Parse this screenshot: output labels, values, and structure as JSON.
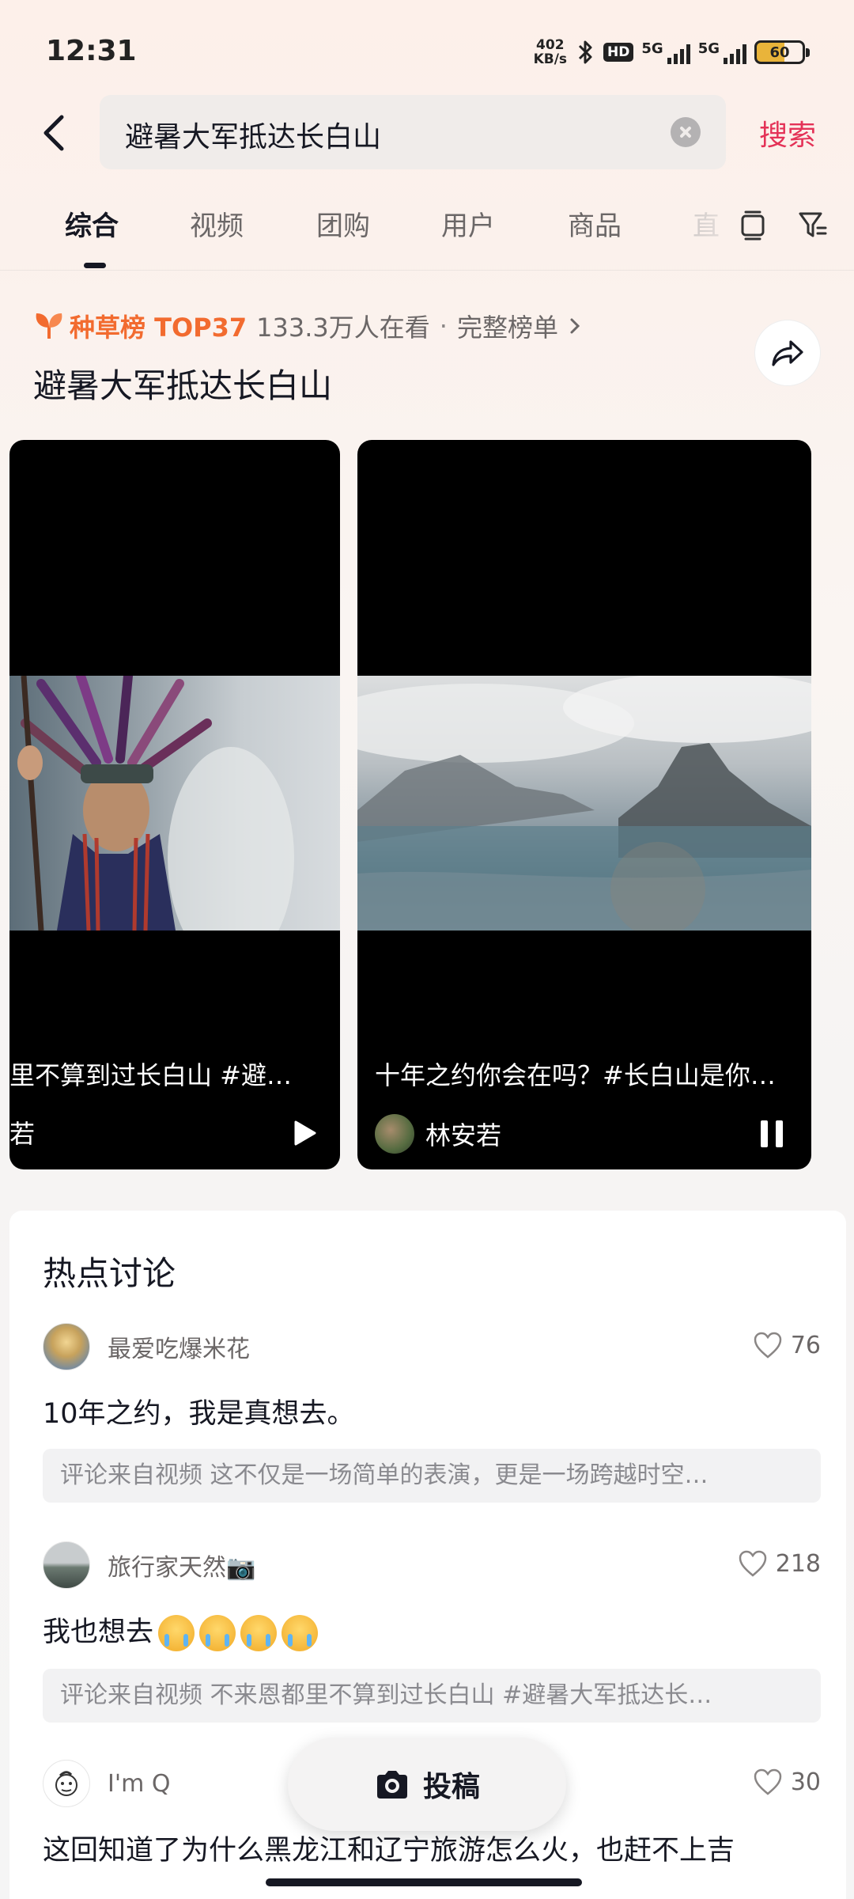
{
  "status_bar": {
    "time": "12:31",
    "net_speed_value": "402",
    "net_speed_unit": "KB/s",
    "hd_label": "HD",
    "signal1_label": "5G",
    "signal2_label": "5G",
    "battery": "60"
  },
  "search": {
    "query": "避暑大军抵达长白山",
    "action_label": "搜索"
  },
  "tabs": [
    {
      "label": "综合",
      "active": true
    },
    {
      "label": "视频"
    },
    {
      "label": "团购"
    },
    {
      "label": "用户"
    },
    {
      "label": "商品"
    },
    {
      "label": "直"
    }
  ],
  "ranking": {
    "badge": "种草榜 TOP37",
    "viewers": "133.3万人在看",
    "separator": "·",
    "full_list": "完整榜单",
    "title": "避暑大军抵达长白山"
  },
  "videos": [
    {
      "caption": "里不算到过长白山 #避…",
      "author": "若",
      "state": "play"
    },
    {
      "caption": "十年之约你会在吗？#长白山是你…",
      "author": "林安若",
      "state": "pause"
    }
  ],
  "hot": {
    "title": "热点讨论",
    "comments": [
      {
        "user": "最爱吃爆米花",
        "likes": "76",
        "text": "10年之约，我是真想去。",
        "source": "评论来自视频 这不仅是一场简单的表演，更是一场跨越时空…"
      },
      {
        "user": "旅行家天然📷",
        "likes": "218",
        "text": "我也想去",
        "source": "评论来自视频 不来恩都里不算到过长白山 #避暑大军抵达长…"
      },
      {
        "user": "I'm Q",
        "likes": "30",
        "text": "这回知道了为什么黑龙江和辽宁旅游怎么火，也赶不上吉"
      }
    ]
  },
  "post_button": {
    "label": "投稿"
  },
  "colors": {
    "accent": "#e43257",
    "rank_orange": "#f26b2f",
    "text": "#161823",
    "muted": "#6b6767"
  }
}
